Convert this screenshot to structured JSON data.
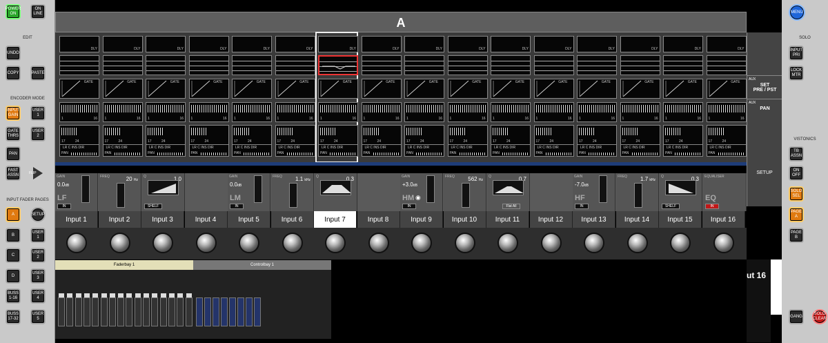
{
  "left_panel": {
    "power_on": "POWER\nON",
    "on_line": "ON\nLINE",
    "edit_heading": "EDIT",
    "undo": "UNDO",
    "copy": "COPY",
    "paste": "PASTE",
    "encoder_mode_heading": "ENCODER MODE",
    "input_gain": "INPUT\nGAIN",
    "user1": "USER\n1",
    "gate_thrs": "GATE\nTHRS",
    "user2": "USER\n2",
    "pan": "PAN",
    "fast_assn": "FAST\nASSN",
    "flip": "FLIP",
    "input_fader_pages_heading": "INPUT FADER PAGES",
    "page_a": "A",
    "setup": "SETUP",
    "page_b": "B",
    "user1b": "USER\n1",
    "page_c": "C",
    "user2b": "USER\n2",
    "page_d": "D",
    "user3": "USER\n3",
    "buss_1_16": "BUSS\n1-16",
    "user4": "USER\n4",
    "buss_17_32": "BUSS\n17-32",
    "user5": "USER\n5"
  },
  "right_panel": {
    "menu": "MENU",
    "solo_heading": "SOLO",
    "input_pri": "INPUT\nPRI",
    "lock_mtr": "LOCK\nMTR",
    "vistonics_heading": "VISTONICS",
    "tb_assn": "TB\nASSN",
    "on_off": "ON\nOFF",
    "solo_sel": "SOLO\nSEL",
    "page_a": "PAGE\nA",
    "page_b": "PAGE\nB",
    "gang": "GANG",
    "solo_clear": "SOLO\nCLEAR"
  },
  "title": "A",
  "strip_labels": {
    "dly": "DLY",
    "gate": "GATE",
    "n1": "1",
    "n16": "16",
    "n17": "17",
    "n24": "24",
    "bus": "LR  C  INS DIR",
    "pan": "PAN"
  },
  "aux": {
    "set_small": "AUX",
    "set": "SET\nPRE / PST",
    "pan_small": "AUX",
    "pan": "PAN",
    "setup": "SETUP"
  },
  "eq": {
    "gain_label": "GAIN",
    "freq_label": "FREQ",
    "q_label": "Q",
    "in_label": "IN",
    "shelf_label": "SHELF",
    "flat_all": "Flat All",
    "equaliser": "EQUALISER",
    "lf": {
      "band": "LF",
      "gain": "0.0",
      "unit": "dB",
      "freq": "20",
      "freq_unit": "Hz",
      "q": "1.0"
    },
    "lm": {
      "band": "LM",
      "gain": "0.0",
      "unit": "dB",
      "freq": "1.1",
      "freq_unit": "kHz",
      "q": "0.3"
    },
    "hm": {
      "band": "HM",
      "gain": "+3.0",
      "unit": "dB",
      "freq": "562",
      "freq_unit": "Hz",
      "q": "0.7"
    },
    "hf": {
      "band": "HF",
      "gain": "-7.0",
      "unit": "dB",
      "freq": "1.7",
      "freq_unit": "kHz",
      "q": "0.3"
    },
    "eq_band": "EQ"
  },
  "channels": [
    "Input 1",
    "Input 2",
    "Input 3",
    "Input 4",
    "Input 5",
    "Input 6",
    "Input 7",
    "Input 8",
    "Input 9",
    "Input 10",
    "Input 11",
    "Input 12",
    "Input 13",
    "Input 14",
    "Input 15",
    "Input 16"
  ],
  "selected_channel": "Input 7",
  "overview": {
    "faderbay": "Faderbay 1",
    "controlbay": "Controlbay 1",
    "partial_label": "ut 16"
  }
}
